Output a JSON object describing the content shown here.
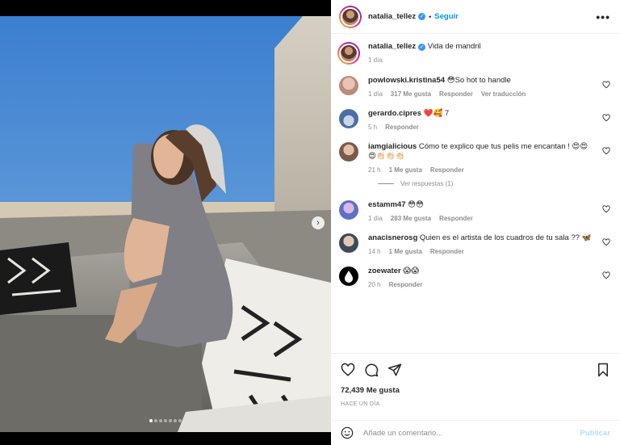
{
  "post": {
    "username": "natalia_tellez",
    "follow_label": "Seguir",
    "caption": "Vida de mandril",
    "caption_time": "1 día",
    "likes": "72,439 Me gusta",
    "posted_ago": "HACE UN DÍA",
    "image_count": 7,
    "active_image": 0
  },
  "comments": [
    {
      "user": "powlowski.kristina54",
      "text": "😳So hot to handle",
      "time": "1 día",
      "likes": "317 Me gusta",
      "reply": "Responder",
      "translate": "Ver traducción"
    },
    {
      "user": "gerardo.cipres",
      "text": "❤️🥰 7",
      "time": "5 h",
      "reply": "Responder"
    },
    {
      "user": "iamgialicious",
      "text": "Cómo te explico que tus pelis me encantan ! 😍😍😍👏🏻👏🏻👏🏻",
      "time": "21 h",
      "likes": "1 Me gusta",
      "reply": "Responder",
      "replies": "Ver respuestas (1)"
    },
    {
      "user": "estamm47",
      "text": "😳😳",
      "time": "1 día",
      "likes": "283 Me gusta",
      "reply": "Responder"
    },
    {
      "user": "anacisnerosg",
      "text": "Quien es el artista de los cuadros de tu sala ?? 🦋",
      "time": "14 h",
      "likes": "1 Me gusta",
      "reply": "Responder"
    },
    {
      "user": "zoewater",
      "text": "😱😱",
      "time": "20 h",
      "reply": "Responder"
    }
  ],
  "composer": {
    "placeholder": "Añade un comentario...",
    "publish_label": "Publicar"
  },
  "icons": {
    "more": "more-options-icon",
    "like": "heart-icon",
    "comment": "comment-icon",
    "share": "share-icon",
    "save": "bookmark-icon",
    "emoji": "emoji-icon",
    "next": "chevron-right-icon"
  },
  "colors": {
    "accent": "#0095f6",
    "muted": "#8e8e8e",
    "verified": "#3897f0"
  }
}
